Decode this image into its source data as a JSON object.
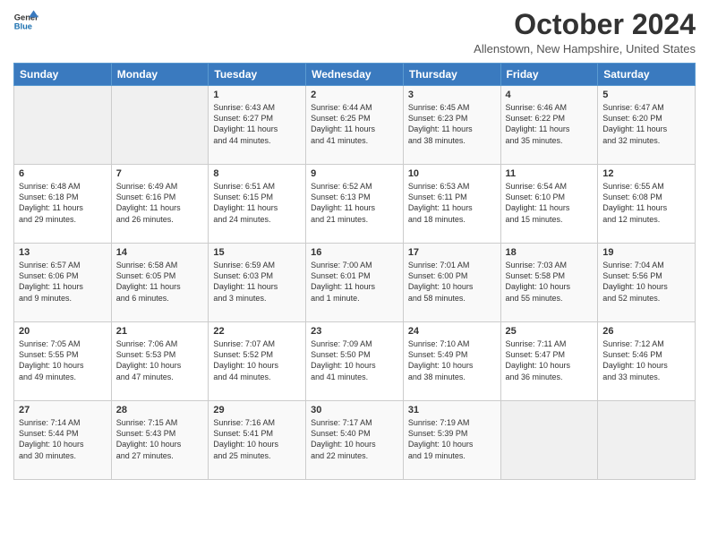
{
  "header": {
    "logo_line1": "General",
    "logo_line2": "Blue",
    "month_title": "October 2024",
    "location": "Allenstown, New Hampshire, United States"
  },
  "days_of_week": [
    "Sunday",
    "Monday",
    "Tuesday",
    "Wednesday",
    "Thursday",
    "Friday",
    "Saturday"
  ],
  "weeks": [
    [
      {
        "day": "",
        "info": ""
      },
      {
        "day": "",
        "info": ""
      },
      {
        "day": "1",
        "info": "Sunrise: 6:43 AM\nSunset: 6:27 PM\nDaylight: 11 hours\nand 44 minutes."
      },
      {
        "day": "2",
        "info": "Sunrise: 6:44 AM\nSunset: 6:25 PM\nDaylight: 11 hours\nand 41 minutes."
      },
      {
        "day": "3",
        "info": "Sunrise: 6:45 AM\nSunset: 6:23 PM\nDaylight: 11 hours\nand 38 minutes."
      },
      {
        "day": "4",
        "info": "Sunrise: 6:46 AM\nSunset: 6:22 PM\nDaylight: 11 hours\nand 35 minutes."
      },
      {
        "day": "5",
        "info": "Sunrise: 6:47 AM\nSunset: 6:20 PM\nDaylight: 11 hours\nand 32 minutes."
      }
    ],
    [
      {
        "day": "6",
        "info": "Sunrise: 6:48 AM\nSunset: 6:18 PM\nDaylight: 11 hours\nand 29 minutes."
      },
      {
        "day": "7",
        "info": "Sunrise: 6:49 AM\nSunset: 6:16 PM\nDaylight: 11 hours\nand 26 minutes."
      },
      {
        "day": "8",
        "info": "Sunrise: 6:51 AM\nSunset: 6:15 PM\nDaylight: 11 hours\nand 24 minutes."
      },
      {
        "day": "9",
        "info": "Sunrise: 6:52 AM\nSunset: 6:13 PM\nDaylight: 11 hours\nand 21 minutes."
      },
      {
        "day": "10",
        "info": "Sunrise: 6:53 AM\nSunset: 6:11 PM\nDaylight: 11 hours\nand 18 minutes."
      },
      {
        "day": "11",
        "info": "Sunrise: 6:54 AM\nSunset: 6:10 PM\nDaylight: 11 hours\nand 15 minutes."
      },
      {
        "day": "12",
        "info": "Sunrise: 6:55 AM\nSunset: 6:08 PM\nDaylight: 11 hours\nand 12 minutes."
      }
    ],
    [
      {
        "day": "13",
        "info": "Sunrise: 6:57 AM\nSunset: 6:06 PM\nDaylight: 11 hours\nand 9 minutes."
      },
      {
        "day": "14",
        "info": "Sunrise: 6:58 AM\nSunset: 6:05 PM\nDaylight: 11 hours\nand 6 minutes."
      },
      {
        "day": "15",
        "info": "Sunrise: 6:59 AM\nSunset: 6:03 PM\nDaylight: 11 hours\nand 3 minutes."
      },
      {
        "day": "16",
        "info": "Sunrise: 7:00 AM\nSunset: 6:01 PM\nDaylight: 11 hours\nand 1 minute."
      },
      {
        "day": "17",
        "info": "Sunrise: 7:01 AM\nSunset: 6:00 PM\nDaylight: 10 hours\nand 58 minutes."
      },
      {
        "day": "18",
        "info": "Sunrise: 7:03 AM\nSunset: 5:58 PM\nDaylight: 10 hours\nand 55 minutes."
      },
      {
        "day": "19",
        "info": "Sunrise: 7:04 AM\nSunset: 5:56 PM\nDaylight: 10 hours\nand 52 minutes."
      }
    ],
    [
      {
        "day": "20",
        "info": "Sunrise: 7:05 AM\nSunset: 5:55 PM\nDaylight: 10 hours\nand 49 minutes."
      },
      {
        "day": "21",
        "info": "Sunrise: 7:06 AM\nSunset: 5:53 PM\nDaylight: 10 hours\nand 47 minutes."
      },
      {
        "day": "22",
        "info": "Sunrise: 7:07 AM\nSunset: 5:52 PM\nDaylight: 10 hours\nand 44 minutes."
      },
      {
        "day": "23",
        "info": "Sunrise: 7:09 AM\nSunset: 5:50 PM\nDaylight: 10 hours\nand 41 minutes."
      },
      {
        "day": "24",
        "info": "Sunrise: 7:10 AM\nSunset: 5:49 PM\nDaylight: 10 hours\nand 38 minutes."
      },
      {
        "day": "25",
        "info": "Sunrise: 7:11 AM\nSunset: 5:47 PM\nDaylight: 10 hours\nand 36 minutes."
      },
      {
        "day": "26",
        "info": "Sunrise: 7:12 AM\nSunset: 5:46 PM\nDaylight: 10 hours\nand 33 minutes."
      }
    ],
    [
      {
        "day": "27",
        "info": "Sunrise: 7:14 AM\nSunset: 5:44 PM\nDaylight: 10 hours\nand 30 minutes."
      },
      {
        "day": "28",
        "info": "Sunrise: 7:15 AM\nSunset: 5:43 PM\nDaylight: 10 hours\nand 27 minutes."
      },
      {
        "day": "29",
        "info": "Sunrise: 7:16 AM\nSunset: 5:41 PM\nDaylight: 10 hours\nand 25 minutes."
      },
      {
        "day": "30",
        "info": "Sunrise: 7:17 AM\nSunset: 5:40 PM\nDaylight: 10 hours\nand 22 minutes."
      },
      {
        "day": "31",
        "info": "Sunrise: 7:19 AM\nSunset: 5:39 PM\nDaylight: 10 hours\nand 19 minutes."
      },
      {
        "day": "",
        "info": ""
      },
      {
        "day": "",
        "info": ""
      }
    ]
  ]
}
